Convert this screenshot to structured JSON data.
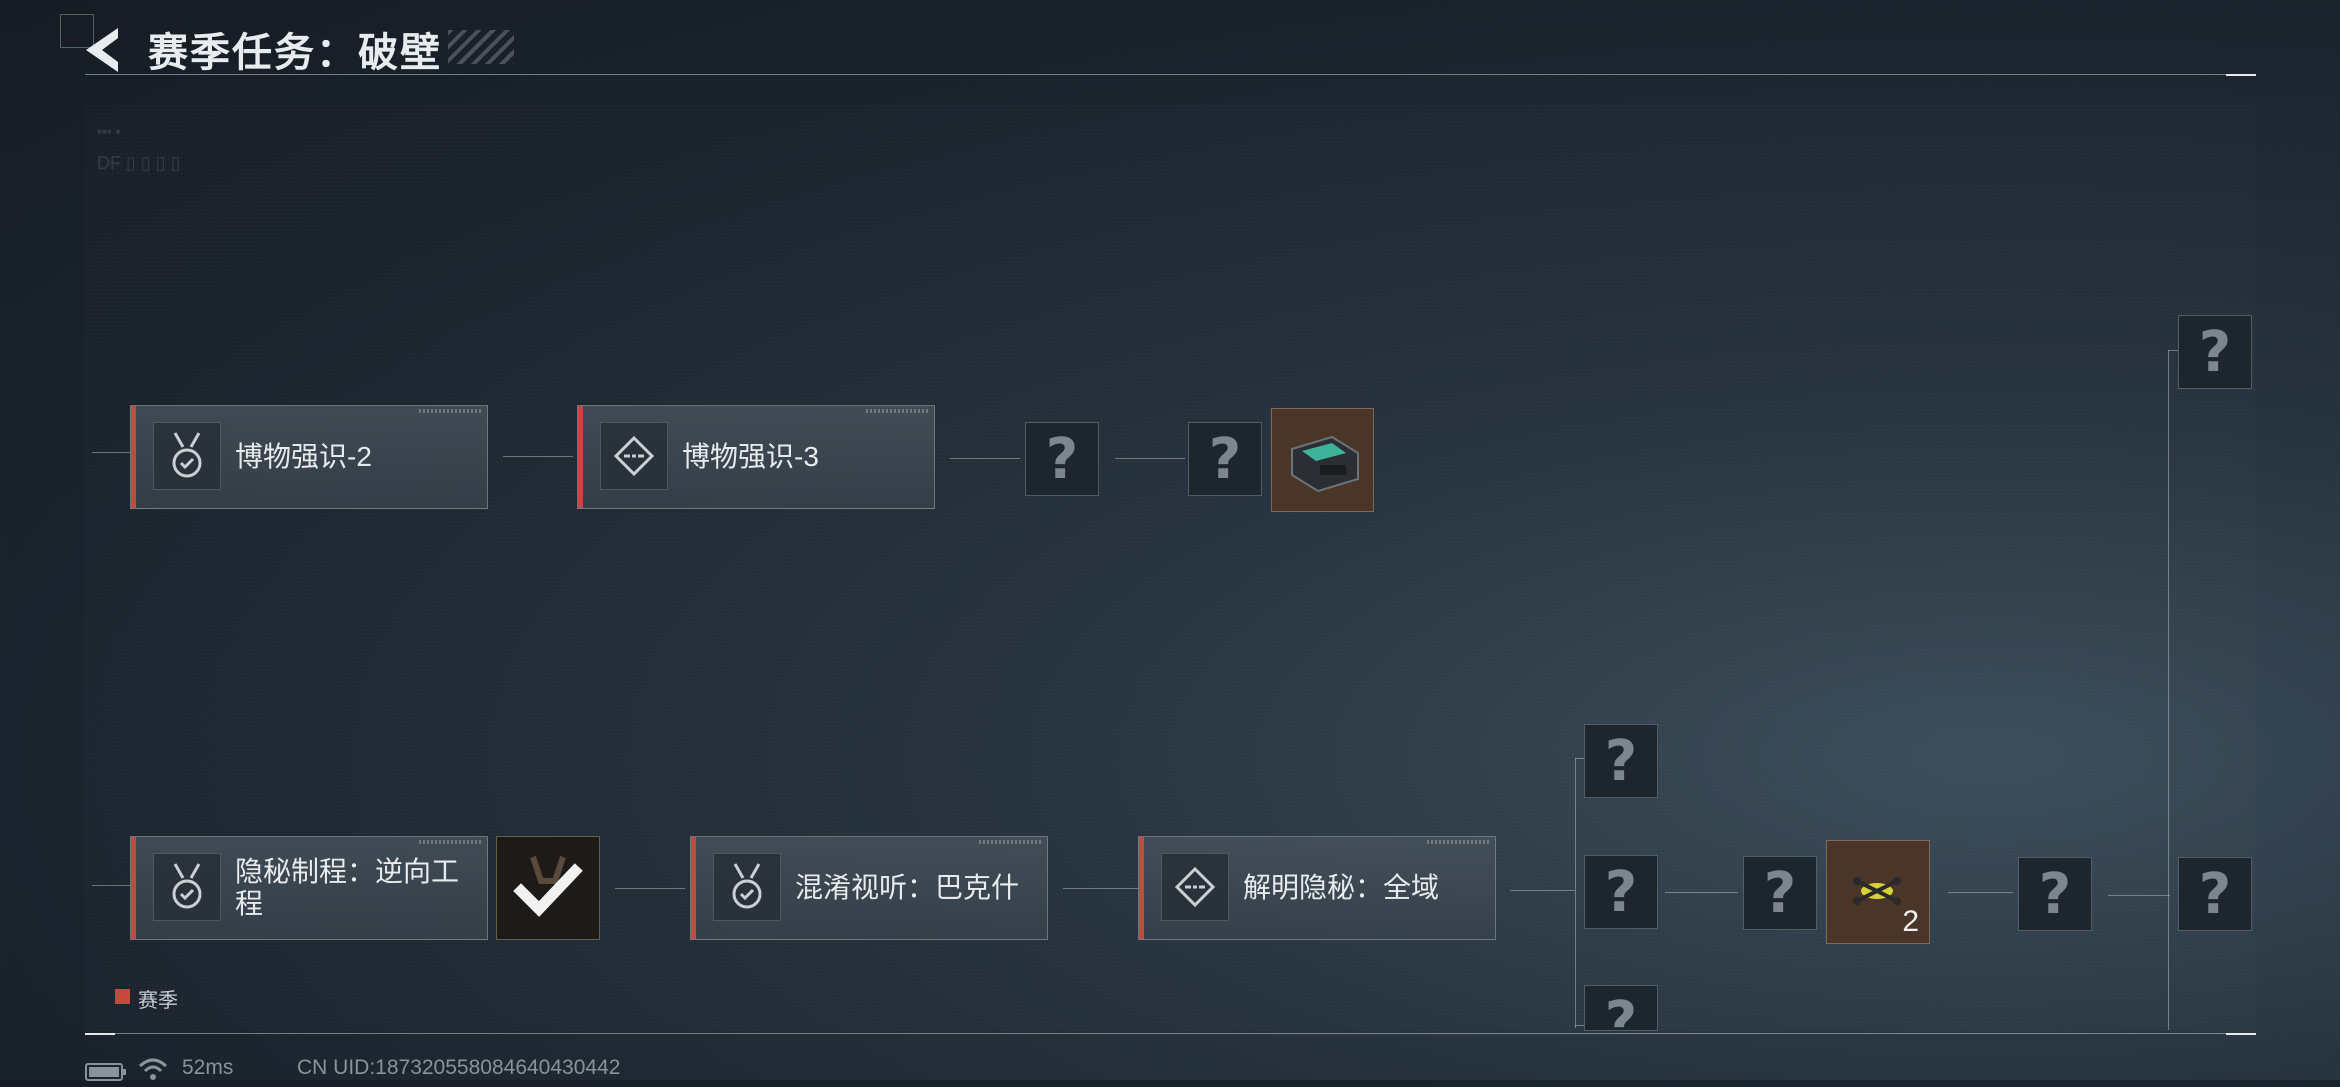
{
  "header": {
    "title": "赛季任务：破壁"
  },
  "tree": {
    "row1": {
      "task1": "博物强识-2",
      "task2": "博物强识-3",
      "unknown_mark": "?"
    },
    "row2": {
      "task1": "隐秘制程：逆向工程",
      "task2": "混淆视听：巴克什",
      "task3": "解明隐秘：全域",
      "unknown_mark": "?",
      "reward_count": "2"
    }
  },
  "legend": {
    "label": "赛季",
    "color": "#c8473f"
  },
  "status": {
    "ping": "52ms",
    "uid": "CN UID:1873205580846404304​42"
  },
  "icons": {
    "back": "back-arrow-icon",
    "medal": "medal-icon",
    "diamond": "diamond-waypoint-icon",
    "battery": "battery-icon",
    "wifi": "wifi-icon",
    "check": "check-icon"
  },
  "colors": {
    "accent": "#c8473f"
  }
}
